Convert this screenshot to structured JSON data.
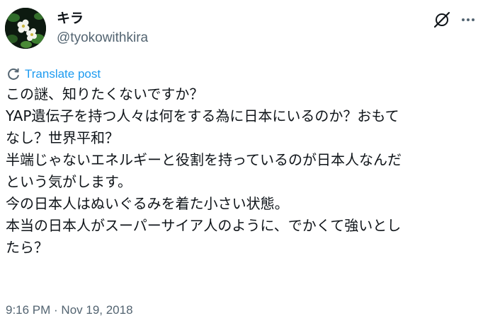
{
  "author": {
    "display_name": "キラ",
    "handle": "@tyokowithkira"
  },
  "icons": {
    "avatar": "avatar-flowers",
    "grok": "grok-icon",
    "more": "more-icon",
    "translate": "translate-icon"
  },
  "translate_label": "Translate post",
  "post": {
    "lines": [
      "この謎、知りたくないですか？",
      "YAP遺伝子を持つ人々は何をする為に日本にいるのか？おもて",
      "なし？世界平和？",
      "半端じゃないエネルギーと役割を持っているのが日本人なんだ",
      "という気がします。",
      "今の日本人はぬいぐるみを着た小さい状態。",
      "本当の日本人がスーパーサイア人のように、でかくて強いとし",
      "たら？"
    ]
  },
  "timestamp": "9:16 PM · Nov 19, 2018",
  "colors": {
    "text": "#0f1419",
    "secondary": "#536471",
    "link": "#1d9bf0",
    "background": "#ffffff"
  }
}
